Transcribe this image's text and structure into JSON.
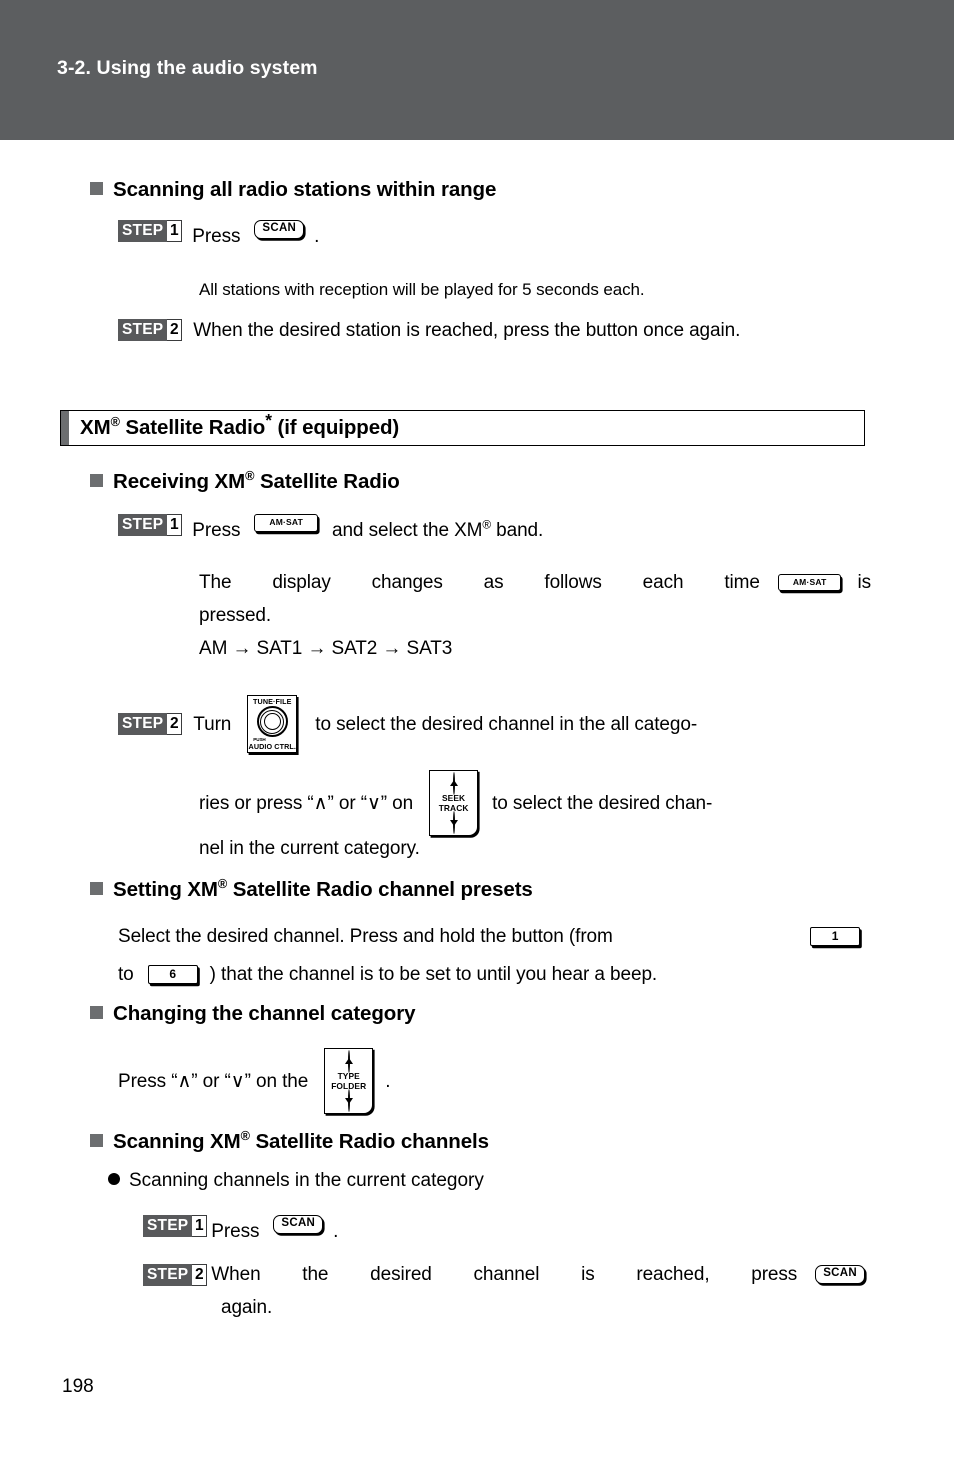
{
  "header": {
    "section_label": "3-2. Using the audio system"
  },
  "page_number": "198",
  "scanning_all": {
    "heading": "Scanning all radio stations within range",
    "step1": {
      "badge": "STEP",
      "number": "1",
      "text_before": "Press",
      "button": "SCAN",
      "text_after": "."
    },
    "note": "All stations with reception will be played for 5 seconds each.",
    "step2": {
      "badge": "STEP",
      "number": "2",
      "text": "When the desired station is reached, press the button once again."
    }
  },
  "xm_section": {
    "title_main": "XM",
    "title_reg": "®",
    "title_rest": " Satellite Radio",
    "title_asterisk": "*",
    "title_tail": " (if equipped)"
  },
  "receiving": {
    "heading_a": "Receiving XM",
    "heading_reg": "®",
    "heading_b": " Satellite Radio",
    "step1": {
      "badge": "STEP",
      "number": "1",
      "text_before": "Press",
      "button": "AM·SAT",
      "text_mid": "and select the XM",
      "reg": "®",
      "text_after": " band."
    },
    "display_note_a": "The display changes as follows each time",
    "display_button": "AM·SAT",
    "display_note_b": "is pressed.",
    "band_sequence": "AM → SAT1 → SAT2 → SAT3",
    "step2": {
      "badge": "STEP",
      "number": "2",
      "text_before": "Turn",
      "knob": {
        "top_label": "TUNE·FILE",
        "push_label": "PUSH",
        "bottom_label": "AUDIO CTRL."
      },
      "text_mid": "to select the desired channel in the all catego-",
      "text_line2_a": "ries or press “∧” or “∨” on",
      "rocker": {
        "line1": "SEEK",
        "line2": "TRACK"
      },
      "text_line2_b": "to select the desired chan-",
      "text_line3": "nel in the current category."
    }
  },
  "presets": {
    "heading_a": "Setting XM",
    "heading_reg": "®",
    "heading_b": " Satellite Radio channel presets",
    "text_a": "Select the desired channel. Press and hold the button (from",
    "button_from": "1",
    "text_b": "to",
    "button_to": "6",
    "text_c": ") that the channel is to be set to until you hear a beep."
  },
  "category": {
    "heading": "Changing the channel category",
    "text_a": "Press “∧” or “∨” on the",
    "rocker": {
      "line1": "TYPE",
      "line2": "FOLDER"
    },
    "text_b": "."
  },
  "scanning_xm": {
    "heading_a": "Scanning XM",
    "heading_reg": "®",
    "heading_b": " Satellite Radio channels",
    "subheading": "Scanning channels in the current category",
    "step1": {
      "badge": "STEP",
      "number": "1",
      "text_before": "Press",
      "button": "SCAN",
      "text_after": "."
    },
    "step2": {
      "badge": "STEP",
      "number": "2",
      "text_before": "When the desired channel is reached, press",
      "button": "SCAN",
      "text_after": "again."
    }
  },
  "colors": {
    "header_band": "#5c5e60",
    "bullet_gray": "#6c6e70",
    "step_badge": "#58595b"
  }
}
